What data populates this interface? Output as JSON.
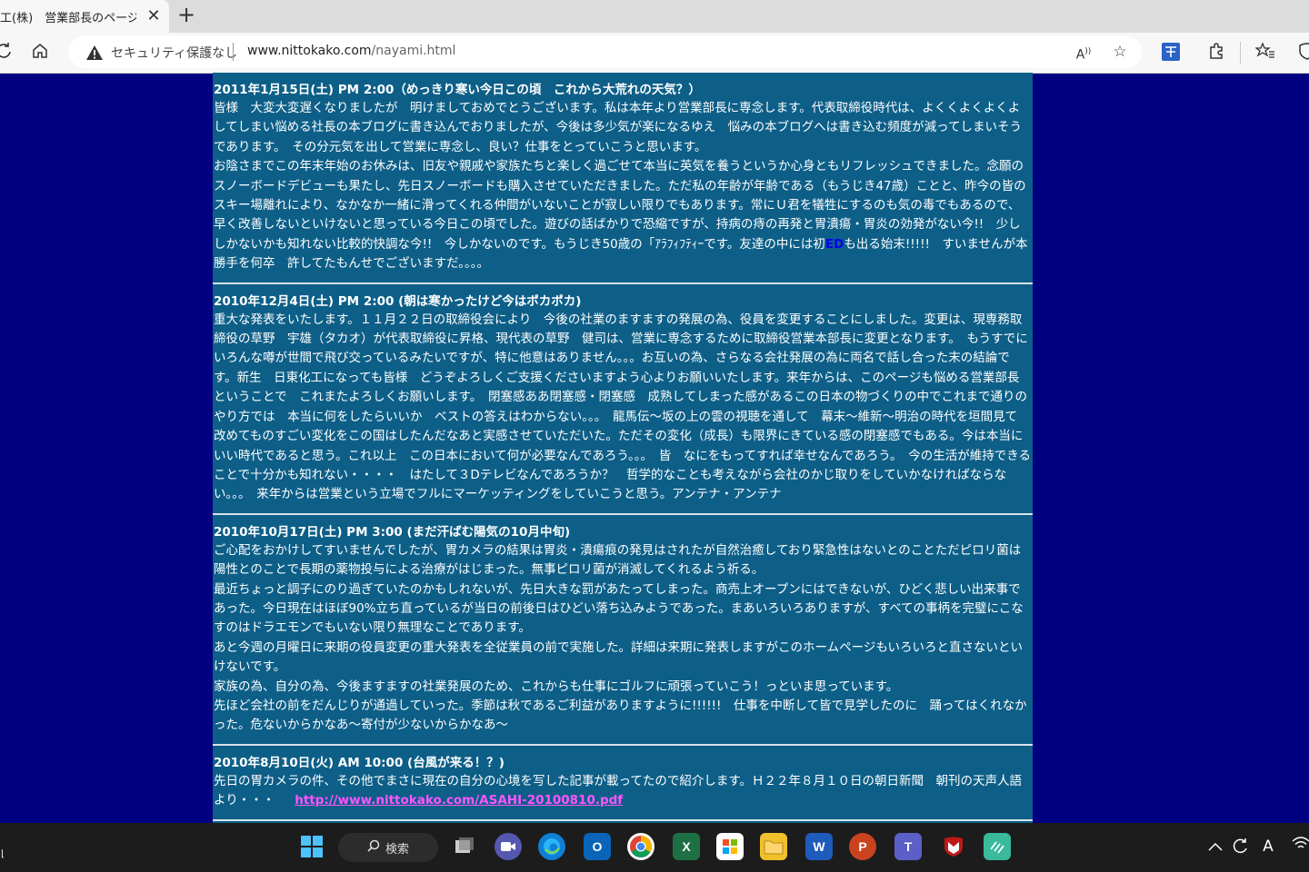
{
  "browser": {
    "tab_title": "工(株)　営業部長のページ",
    "tab_close": "✕",
    "new_tab": "+",
    "security_label": "セキュリティ保護なし",
    "url_host": "www.nittokako.com",
    "url_path": "/nayami.html"
  },
  "posts": [
    {
      "date": "2011年1月15日(土) PM 2:00（めっきり寒い今日この頃　これから大荒れの天気？）",
      "paragraphs": [
        "皆様　大変大変遅くなりましたが　明けましておめでとうございます。私は本年より営業部長に専念します。代表取締役時代は、よくくよくよくよしてしまい悩める社長の本ブログに書き込んでおりましたが、今後は多少気が楽になるゆえ　悩みの本ブログへは書き込む頻度が減ってしまいそうであります。　その分元気を出して営業に専念し、良い？仕事をとっていこうと思います。",
        "お陰さまでこの年末年始のお休みは、旧友や親戚や家族たちと楽しく過ごせて本当に英気を養うというか心身ともリフレッシュできました。念願のスノーボードデビューも果たし、先日スノーボードも購入させていただきました。ただ私の年齢が年齢である（もうじき47歳）ことと、昨今の皆のスキー場離れにより、なかなか一緒に滑ってくれる仲間がいないことが寂しい限りでもあります。常にＵ君を犠牲にするのも気の毒でもあるので、早く改善しないといけないと思っている今日この頃でした。遊びの話ばかりで恐縮ですが、持病の痔の再発と胃潰瘍・胃炎の効発がない今!!　少ししかないかも知れない比較的快調な今!!　今しかないのです。もうじき50歳の「ｱﾗﾌｨﾌﾃｨｰです。友達の中には初"
      ],
      "ed_text": "ED",
      "tail_text": "も出る始末!!!!!　すいませんが本勝手を何卒　許してたもんせでございますだ。。。。"
    },
    {
      "date": "2010年12月4日(土) PM 2:00 (朝は寒かったけど今はポカポカ)",
      "paragraphs": [
        "重大な発表をいたします。１１月２２日の取締役会により　今後の社業のますますの発展の為、役員を変更することにしました。変更は、現専務取締役の草野　宇雄（タカオ）が代表取締役に昇格、現代表の草野　健司は、営業に専念するために取締役営業本部長に変更となります。　もうすでにいろんな噂が世間で飛び交っているみたいですが、特に他意はありません。。。お互いの為、さらなる会社発展の為に両名で話し合った末の結論です。新生　日東化工になっても皆様　どうぞよろしくご支援くださいますよう心よりお願いいたします。来年からは、このページも悩める営業部長ということで　これまたよろしくお願いします。　閉塞感ああ閉塞感・閉塞感　成熟してしまった感があるこの日本の物づくりの中でこれまで通りのやり方では　本当に何をしたらいいか　ベストの答えはわからない。。。　龍馬伝～坂の上の雲の視聴を通して　幕末～維新～明治の時代を垣間見て　改めてものすごい変化をこの国はしたんだなあと実感させていただいた。ただその変化（成長）も限界にきている感の閉塞感でもある。今は本当にいい時代であると思う。これ以上　この日本において何が必要なんであろう。。。　皆　なにをもってすれば幸せなんであろう。　今の生活が維持できることで十分かも知れない・・・・　はたして３Dテレビなんであろうか？　哲学的なことも考えながら会社のかじ取りをしていかなければならない。。。　来年からは営業という立場でフルにマーケッティングをしていこうと思う。アンテナ・アンテナ"
      ]
    },
    {
      "date": "2010年10月17日(土) PM 3:00 (まだ汗ばむ陽気の10月中旬)",
      "paragraphs": [
        "ご心配をおかけしてすいませんでしたが、胃カメラの結果は胃炎・潰瘍痕の発見はされたが自然治癒しており緊急性はないとのことただピロリ菌は陽性とのことで長期の薬物投与による治療がはじまった。無事ピロリ菌が消滅してくれるよう祈る。",
        "最近ちょっと調子にのり過ぎていたのかもしれないが、先日大きな罰があたってしまった。商売上オープンにはできないが、ひどく悲しい出来事であった。今日現在はほぼ90%立ち直っているが当日の前後日はひどい落ち込みようであった。まあいろいろありますが、すべての事柄を完璧にこなすのはドラエモンでもいない限り無理なことであります。",
        "あと今週の月曜日に来期の役員変更の重大発表を全従業員の前で実施した。詳細は来期に発表しますがこのホームページもいろいろと直さないといけないです。",
        "家族の為、自分の為、今後ますますの社業発展のため、これからも仕事にゴルフに頑張っていこう！っといま思っています。",
        "先ほど会社の前をだんじりが通過していった。季節は秋であるご利益がありますように!!!!!!　仕事を中断して皆で見学したのに　踊ってはくれなかった。危ないからかなあ～寄付が少ないからかなあ～"
      ]
    },
    {
      "date": "2010年8月10日(火) AM 10:00 (台風が来る！？)",
      "paragraphs": [
        "先日の胃カメラの件、その他でまさに現在の自分の心境を写した記事が載ってたので紹介します。Ｈ２２年８月１０日の朝日新聞　朝刊の天声人語より・・・"
      ],
      "link": "http://www.nittokako.com/ASAHI-20100810.pdf"
    }
  ],
  "taskbar": {
    "search_label": "検索",
    "apps": [
      "start",
      "search",
      "task-view",
      "teams-meet",
      "edge",
      "outlook",
      "chrome",
      "excel",
      "store",
      "explorer",
      "word",
      "powerpoint",
      "teams",
      "mcafee",
      "app"
    ]
  },
  "colors": {
    "page_bg": "#000080",
    "content_bg": "#0d5f88",
    "link": "#ff55ff",
    "ed": "#0000ee"
  }
}
